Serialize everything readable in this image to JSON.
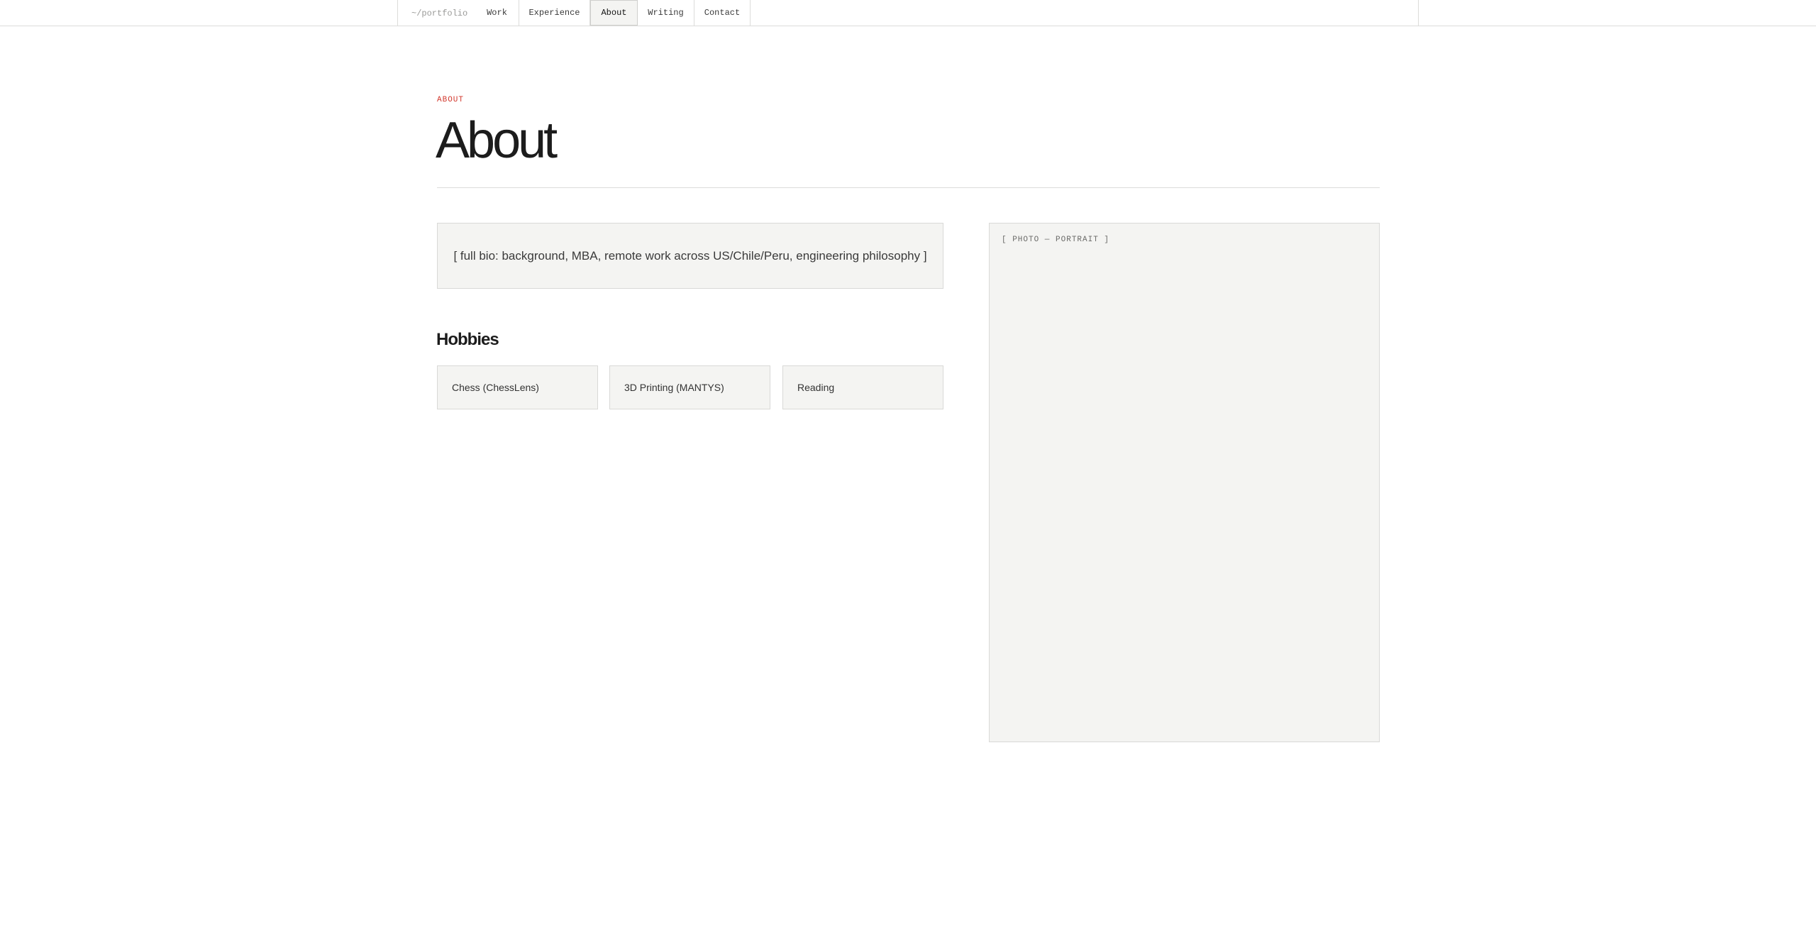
{
  "nav": {
    "brand": "~/portfolio",
    "items": [
      {
        "label": "Work",
        "active": false
      },
      {
        "label": "Experience",
        "active": false
      },
      {
        "label": "About",
        "active": true
      },
      {
        "label": "Writing",
        "active": false
      },
      {
        "label": "Contact",
        "active": false
      }
    ]
  },
  "header": {
    "eyebrow": "ABOUT",
    "title": "About"
  },
  "bio": {
    "text": "[ full bio: background, MBA, remote work across US/Chile/Peru, engineering philosophy ]"
  },
  "hobbies": {
    "title": "Hobbies",
    "items": [
      "Chess (ChessLens)",
      "3D Printing (MANTYS)",
      "Reading"
    ]
  },
  "portrait": {
    "label": "[ PHOTO — PORTRAIT ]"
  },
  "colors": {
    "accent": "#d2362b",
    "panel": "#f4f4f2",
    "border": "#d9d9d7"
  }
}
